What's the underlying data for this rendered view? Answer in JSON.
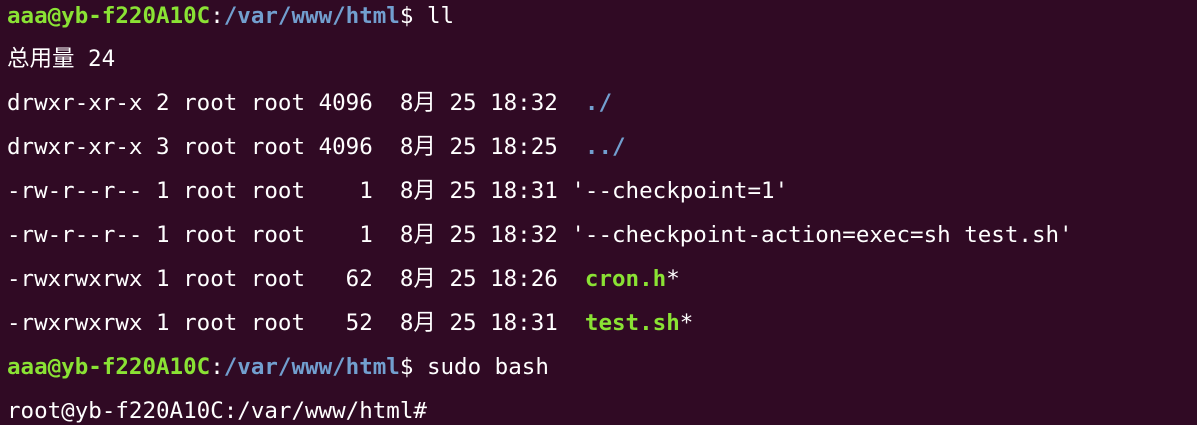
{
  "terminal": {
    "background": "#300a24",
    "prompt_user_color": "#8ae234",
    "prompt_dir_color": "#729fcf",
    "lines": [
      {
        "user": "aaa@yb-f220A10C",
        "sep": ":",
        "dir": "/var/www/html",
        "tail": "$ ll"
      },
      {
        "text": "总用量 24"
      },
      {
        "perm": "drwxr-xr-x",
        "links": "2",
        "owner": "root",
        "group": "root",
        "size": "4096",
        "month": "8月",
        "day": "25",
        "time": "18:32",
        "name_pre": " ",
        "name": "./",
        "name_type": "dir"
      },
      {
        "perm": "drwxr-xr-x",
        "links": "3",
        "owner": "root",
        "group": "root",
        "size": "4096",
        "month": "8月",
        "day": "25",
        "time": "18:25",
        "name_pre": " ",
        "name": "../",
        "name_type": "dir"
      },
      {
        "perm": "-rw-r--r--",
        "links": "1",
        "owner": "root",
        "group": "root",
        "size": "1",
        "month": "8月",
        "day": "25",
        "time": "18:31",
        "name_pre": "",
        "name": "'--checkpoint=1'",
        "name_type": "plain"
      },
      {
        "perm": "-rw-r--r--",
        "links": "1",
        "owner": "root",
        "group": "root",
        "size": "1",
        "month": "8月",
        "day": "25",
        "time": "18:32",
        "name_pre": "",
        "name": "'--checkpoint-action=exec=sh test.sh'",
        "name_type": "plain"
      },
      {
        "perm": "-rwxrwxrwx",
        "links": "1",
        "owner": "root",
        "group": "root",
        "size": "62",
        "month": "8月",
        "day": "25",
        "time": "18:26",
        "name_pre": " ",
        "name": "cron.h",
        "name_type": "exe",
        "suffix": "*"
      },
      {
        "perm": "-rwxrwxrwx",
        "links": "1",
        "owner": "root",
        "group": "root",
        "size": "52",
        "month": "8月",
        "day": "25",
        "time": "18:31",
        "name_pre": " ",
        "name": "test.sh",
        "name_type": "exe",
        "suffix": "*"
      },
      {
        "user": "aaa@yb-f220A10C",
        "sep": ":",
        "dir": "/var/www/html",
        "tail": "$ sudo bash"
      },
      {
        "text": "root@yb-f220A10C:/var/www/html#"
      }
    ]
  }
}
